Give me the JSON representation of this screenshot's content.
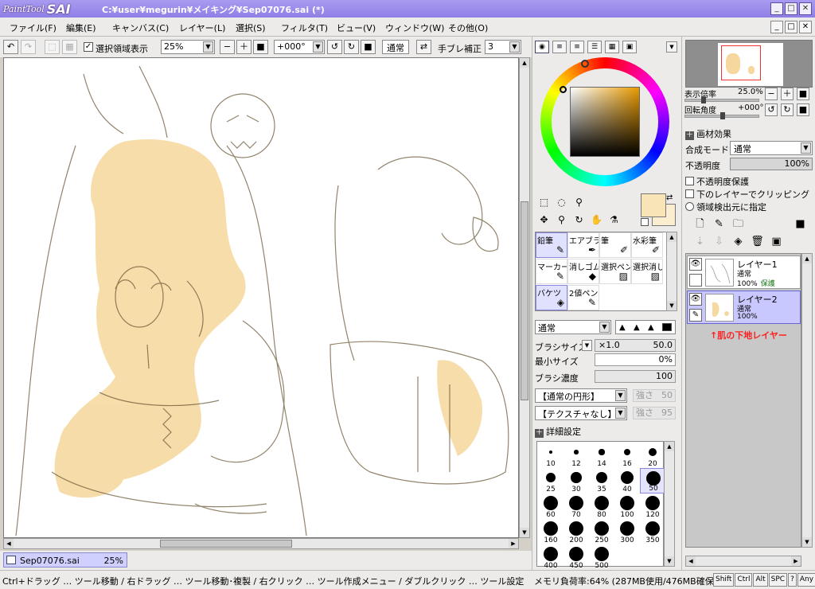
{
  "window": {
    "logo_paint": "PaintTool",
    "logo_sai": "SAI",
    "title": "C:¥user¥megurin¥メイキング¥Sep07076.sai (*)",
    "accent": "#8e7fe6"
  },
  "menu": [
    "ファイル(F)",
    "編集(E)",
    "キャンバス(C)",
    "レイヤー(L)",
    "選択(S)",
    "フィルタ(T)",
    "ビュー(V)",
    "ウィンドウ(W)",
    "その他(O)"
  ],
  "toolbar": {
    "show_selection_checked": true,
    "show_selection_label": "選択領域表示",
    "zoom": "25%",
    "angle": "+000°",
    "blend": "通常",
    "stabilizer_label": "手ブレ補正",
    "stabilizer_value": "3"
  },
  "doc_tab": {
    "name": "Sep07076.sai",
    "zoom": "25%"
  },
  "status": {
    "hint": "Ctrl+ドラッグ … ツール移動 / 右ドラッグ … ツール移動･複製 / 右クリック … ツール作成メニュー / ダブルクリック … ツール設定",
    "memory": "メモリ負荷率:64% (287MB使用/476MB確保)",
    "keys": [
      "Shift",
      "Ctrl",
      "Alt",
      "SPC",
      "Any"
    ]
  },
  "color": {
    "foreground": "#f9e4b7",
    "background": "#fbedd0"
  },
  "tools": {
    "brushes": [
      {
        "label": "鉛筆",
        "icon": "pencil-icon",
        "active": true
      },
      {
        "label": "エアブラシ",
        "icon": "airbrush-icon",
        "active": false
      },
      {
        "label": "筆",
        "icon": "brush-icon",
        "active": false
      },
      {
        "label": "水彩筆",
        "icon": "watercolor-icon",
        "active": false
      },
      {
        "label": "マーカー",
        "icon": "marker-icon",
        "active": false
      },
      {
        "label": "消しゴム",
        "icon": "eraser-icon",
        "active": false
      },
      {
        "label": "選択ペン",
        "icon": "select-pen-icon",
        "active": false
      },
      {
        "label": "選択消し",
        "icon": "deselect-icon",
        "active": false
      },
      {
        "label": "バケツ",
        "icon": "bucket-icon",
        "active": true
      },
      {
        "label": "2値ペン",
        "icon": "binary-pen-icon",
        "active": false
      }
    ]
  },
  "brush_settings": {
    "blend": "通常",
    "size_label": "ブラシサイズ",
    "size_multiplier": "×1.0",
    "size_value": "50.0",
    "min_size_label": "最小サイズ",
    "min_size_value": "0%",
    "density_label": "ブラシ濃度",
    "density_value": "100",
    "shape_combo": "【通常の円形】",
    "shape_strength_label": "強さ",
    "shape_strength": "50",
    "texture_combo": "【テクスチャなし】",
    "texture_strength_label": "強さ",
    "texture_strength": "95",
    "detail_label": "詳細設定"
  },
  "sizes": [
    "10",
    "12",
    "14",
    "16",
    "20",
    "25",
    "30",
    "35",
    "40",
    "50",
    "60",
    "70",
    "80",
    "100",
    "120",
    "160",
    "200",
    "250",
    "300",
    "350",
    "400",
    "450",
    "500"
  ],
  "selected_size": "50",
  "navigator": {
    "zoom_label": "表示倍率",
    "zoom_value": "25.0%",
    "rotate_label": "回転角度",
    "rotate_value": "+000°"
  },
  "layer_props": {
    "effect_label": "画材効果",
    "mode_label": "合成モード",
    "mode_value": "通常",
    "opacity_label": "不透明度",
    "opacity_value": "100%",
    "preserve_opacity": "不透明度保護",
    "clip_below": "下のレイヤーでクリッピング",
    "selection_source": "領域検出元に指定"
  },
  "layers": [
    {
      "name": "レイヤー1",
      "mode": "通常",
      "opacity": "100%",
      "protect": "保護",
      "selected": false
    },
    {
      "name": "レイヤー2",
      "mode": "通常",
      "opacity": "100%",
      "protect": "",
      "selected": true
    }
  ],
  "annotation": "↑肌の下地レイヤー"
}
